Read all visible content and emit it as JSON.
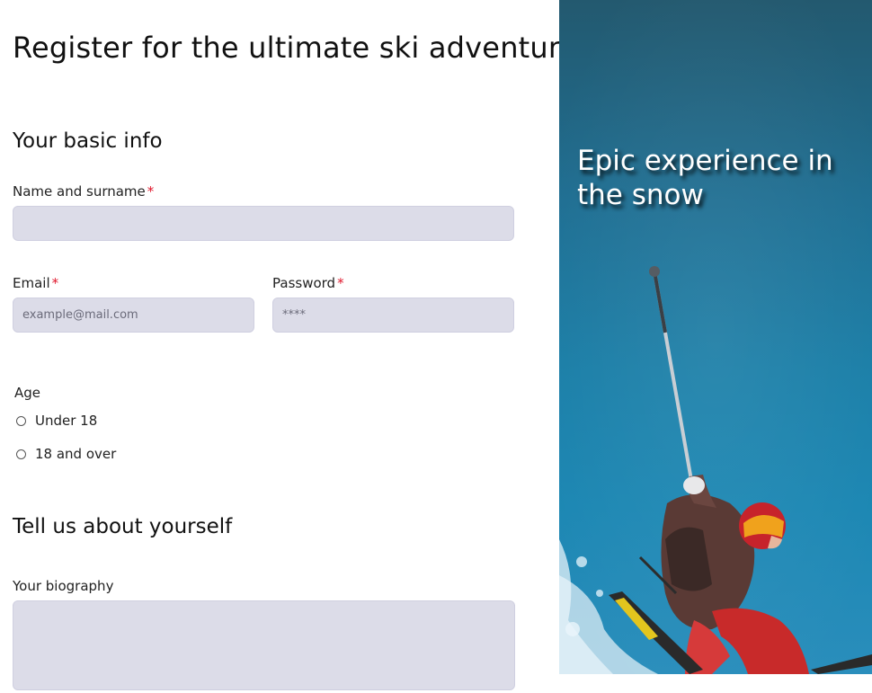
{
  "page": {
    "title": "Register for the ultimate ski adventure"
  },
  "basic_info": {
    "heading": "Your basic info",
    "name_label": "Name and surname",
    "required_marker": "*",
    "name_value": "",
    "email_label": "Email",
    "email_placeholder": "example@mail.com",
    "password_label": "Password",
    "password_placeholder": "****"
  },
  "age": {
    "label": "Age",
    "options": [
      "Under 18",
      "18 and over"
    ]
  },
  "about": {
    "heading": "Tell us about yourself",
    "bio_label": "Your biography",
    "bio_value": ""
  },
  "hero": {
    "title": "Epic experience in the snow",
    "image_description_icon": "skier-photo"
  },
  "colors": {
    "field_bg": "#dcdce8",
    "required": "#e0162b",
    "sky": "#1b7fa8"
  }
}
